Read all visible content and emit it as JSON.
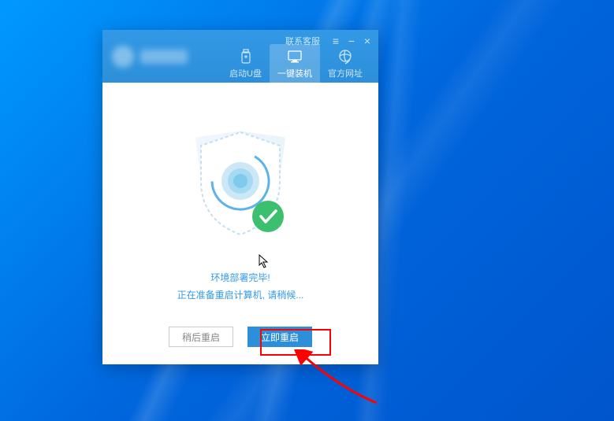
{
  "titlebar": {
    "contact_label": "联系客服"
  },
  "tabs": {
    "boot_usb": "启动U盘",
    "one_click": "一键装机",
    "official_site": "官方网址"
  },
  "status": {
    "line1": "环境部署完毕!",
    "line2": "正在准备重启计算机, 请稍候..."
  },
  "buttons": {
    "later": "稍后重启",
    "now": "立即重启"
  }
}
